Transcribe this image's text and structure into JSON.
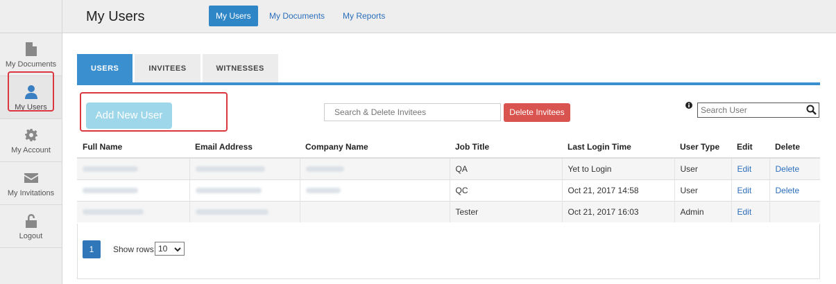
{
  "header": {
    "title": "My Users",
    "tabs": [
      {
        "label": "My Users",
        "active": true
      },
      {
        "label": "My Documents",
        "active": false
      },
      {
        "label": "My Reports",
        "active": false
      }
    ]
  },
  "sidebar": {
    "items": [
      {
        "label": "My Documents",
        "icon": "document-icon"
      },
      {
        "label": "My Users",
        "icon": "user-icon",
        "active": true
      },
      {
        "label": "My Account",
        "icon": "gear-icon"
      },
      {
        "label": "My Invitations",
        "icon": "envelope-icon"
      },
      {
        "label": "Logout",
        "icon": "unlock-icon"
      }
    ]
  },
  "tabs": [
    {
      "label": "USERS",
      "active": true
    },
    {
      "label": "INVITEES",
      "active": false
    },
    {
      "label": "WITNESSES",
      "active": false
    }
  ],
  "toolbar": {
    "add_user_label": "Add New User",
    "search_invitees_placeholder": "Search & Delete Invitees",
    "delete_invitees_label": "Delete Invitees",
    "search_user_placeholder": "Search User"
  },
  "table": {
    "columns": [
      "Full Name",
      "Email Address",
      "Company Name",
      "Job Title",
      "Last Login Time",
      "User Type",
      "Edit",
      "Delete"
    ],
    "rows": [
      {
        "job_title": "QA",
        "last_login": "Yet to Login",
        "user_type": "User",
        "edit": "Edit",
        "delete": "Delete"
      },
      {
        "job_title": "QC",
        "last_login": "Oct 21, 2017 14:58",
        "user_type": "User",
        "edit": "Edit",
        "delete": "Delete"
      },
      {
        "job_title": "Tester",
        "last_login": "Oct 21, 2017 16:03",
        "user_type": "Admin",
        "edit": "Edit",
        "delete": ""
      }
    ]
  },
  "pagination": {
    "current_page": "1",
    "show_rows_label": "Show rows:",
    "rows_value": "10"
  },
  "colors": {
    "accent": "#3a8fcf",
    "danger": "#d9534f",
    "highlight": "#d9363e"
  }
}
